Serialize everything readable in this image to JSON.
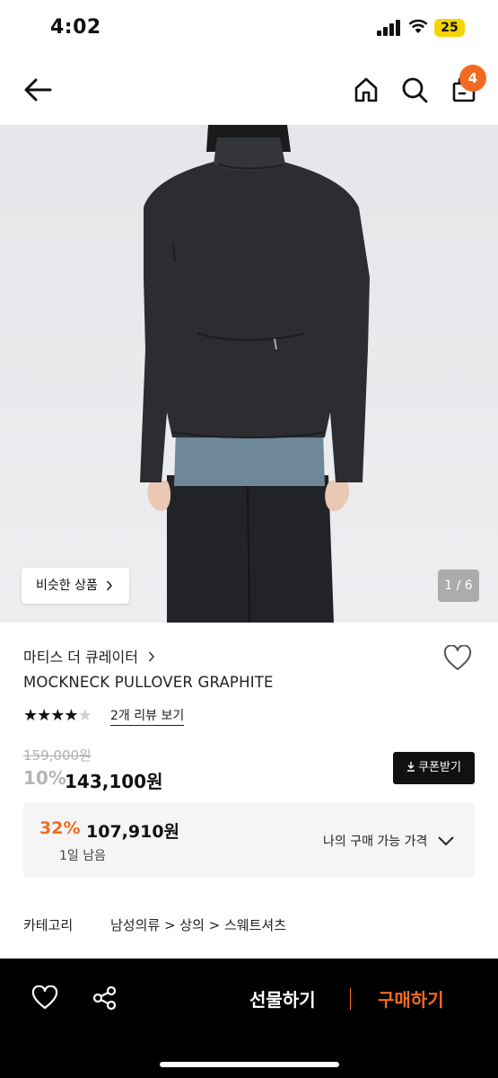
{
  "status_bar": {
    "time": "4:02",
    "battery": "25"
  },
  "nav": {
    "cart_count": "4"
  },
  "gallery": {
    "similar_label": "비슷한 상품",
    "page_indicator": "1 / 6"
  },
  "product": {
    "brand": "마티스 더 큐레이터",
    "name": "MOCKNECK PULLOVER GRAPHITE",
    "rating": 4,
    "rating_max": 5,
    "review_link": "2개 리뷰 보기",
    "original_price": "159,000원",
    "discount_rate": "10%",
    "price": "143,100원",
    "coupon_label": "쿠폰받기"
  },
  "my_price": {
    "rate": "32%",
    "price": "107,910원",
    "days_left": "1일 남음",
    "label": "나의 구매 가능 가격"
  },
  "category": {
    "label": "카테고리",
    "path": "남성의류 > 상의 > 스웨트셔츠"
  },
  "bottom_bar": {
    "gift_label": "선물하기",
    "buy_label": "구매하기"
  },
  "colors": {
    "accent": "#f26a22",
    "bottom_bar": "#000000",
    "jacket": "#2b2d30",
    "tee": "#6e8799"
  }
}
